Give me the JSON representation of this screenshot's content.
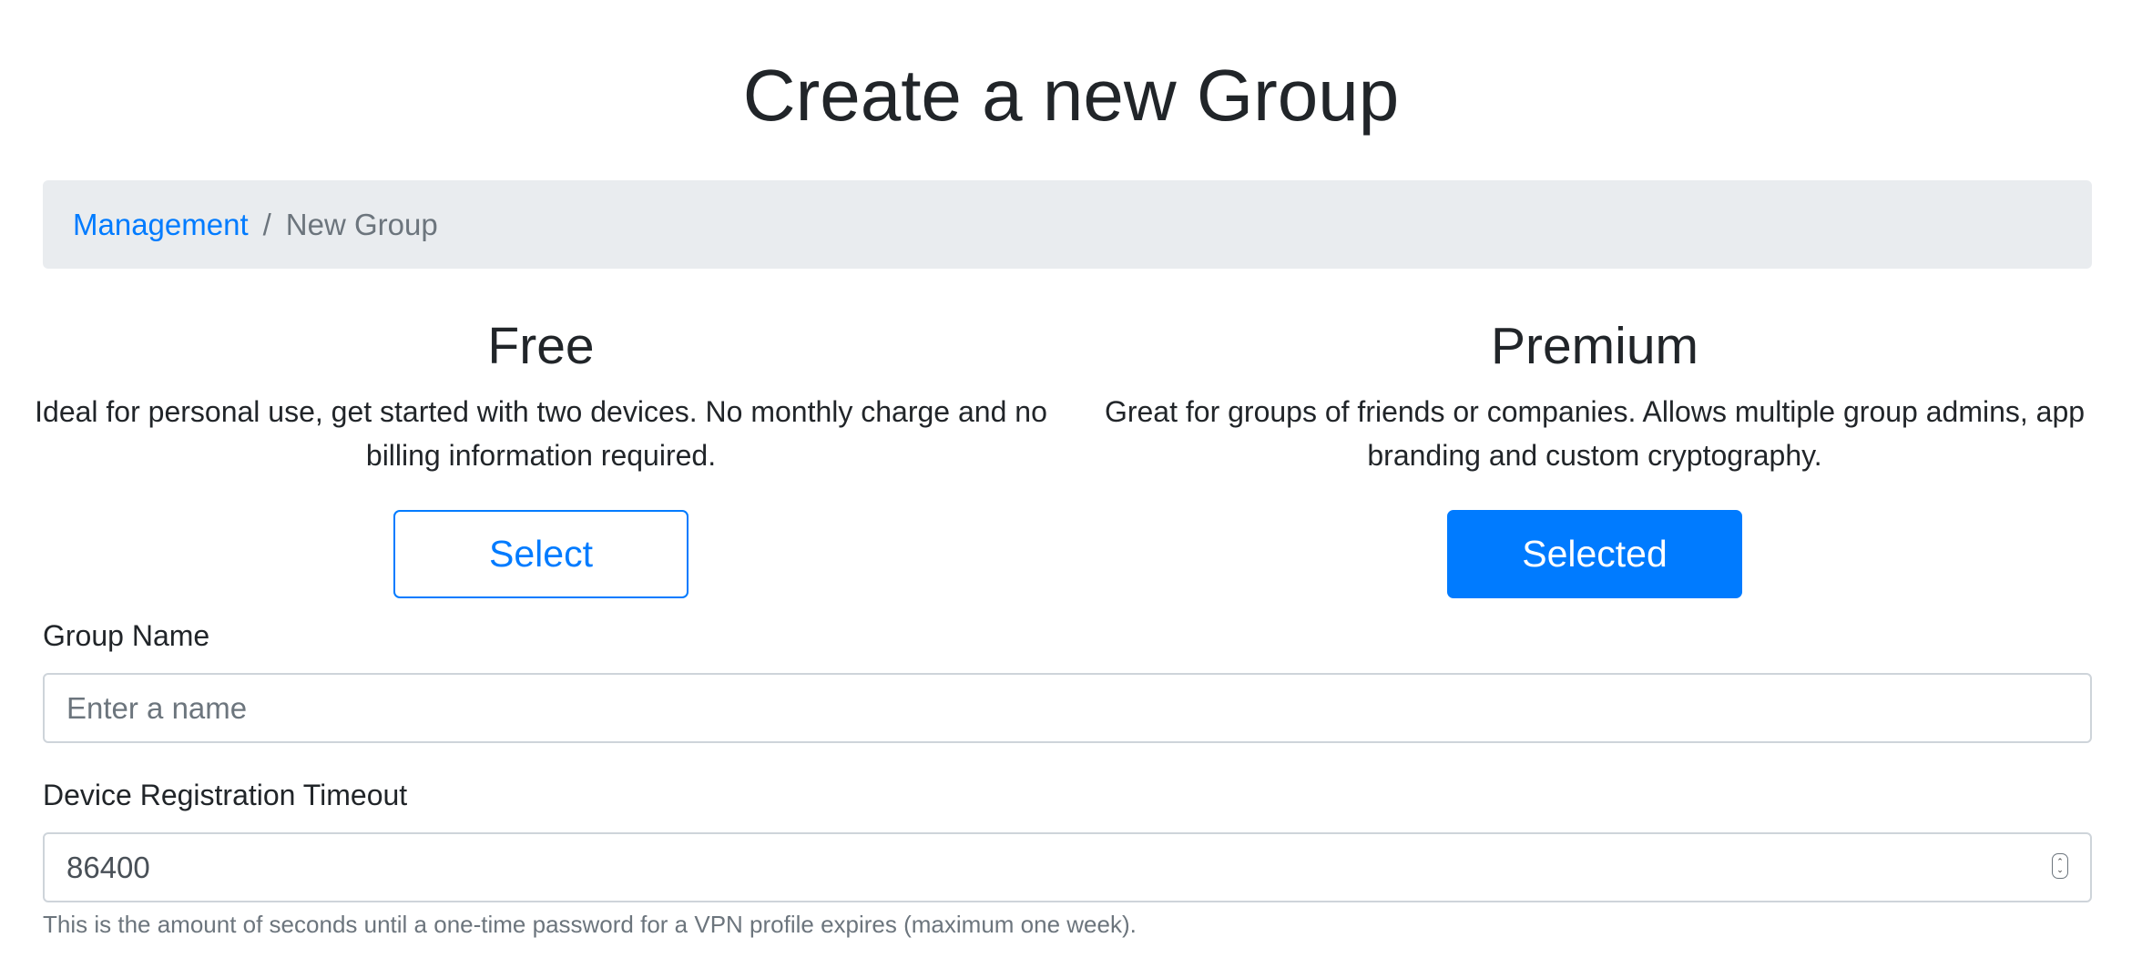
{
  "page": {
    "title": "Create a new Group"
  },
  "breadcrumb": {
    "items": [
      {
        "label": "Management",
        "link": true
      },
      {
        "label": "New Group",
        "link": false
      }
    ],
    "separator": "/"
  },
  "plans": [
    {
      "title": "Free",
      "description": "Ideal for personal use, get started with two devices. No monthly charge and no billing information required.",
      "button_label": "Select",
      "selected": false
    },
    {
      "title": "Premium",
      "description": "Great for groups of friends or companies. Allows multiple group admins, app branding and custom cryptography.",
      "button_label": "Selected",
      "selected": true
    }
  ],
  "form": {
    "group_name": {
      "label": "Group Name",
      "placeholder": "Enter a name",
      "value": ""
    },
    "timeout": {
      "label": "Device Registration Timeout",
      "value": "86400",
      "help": "This is the amount of seconds until a one-time password for a VPN profile expires (maximum one week)."
    }
  },
  "colors": {
    "primary": "#007bff",
    "breadcrumb_bg": "#e9ecef",
    "muted": "#6c757d",
    "text": "#212529",
    "input_border": "#ced4da"
  },
  "icons": {
    "spinner": "number-spinner-icon"
  }
}
